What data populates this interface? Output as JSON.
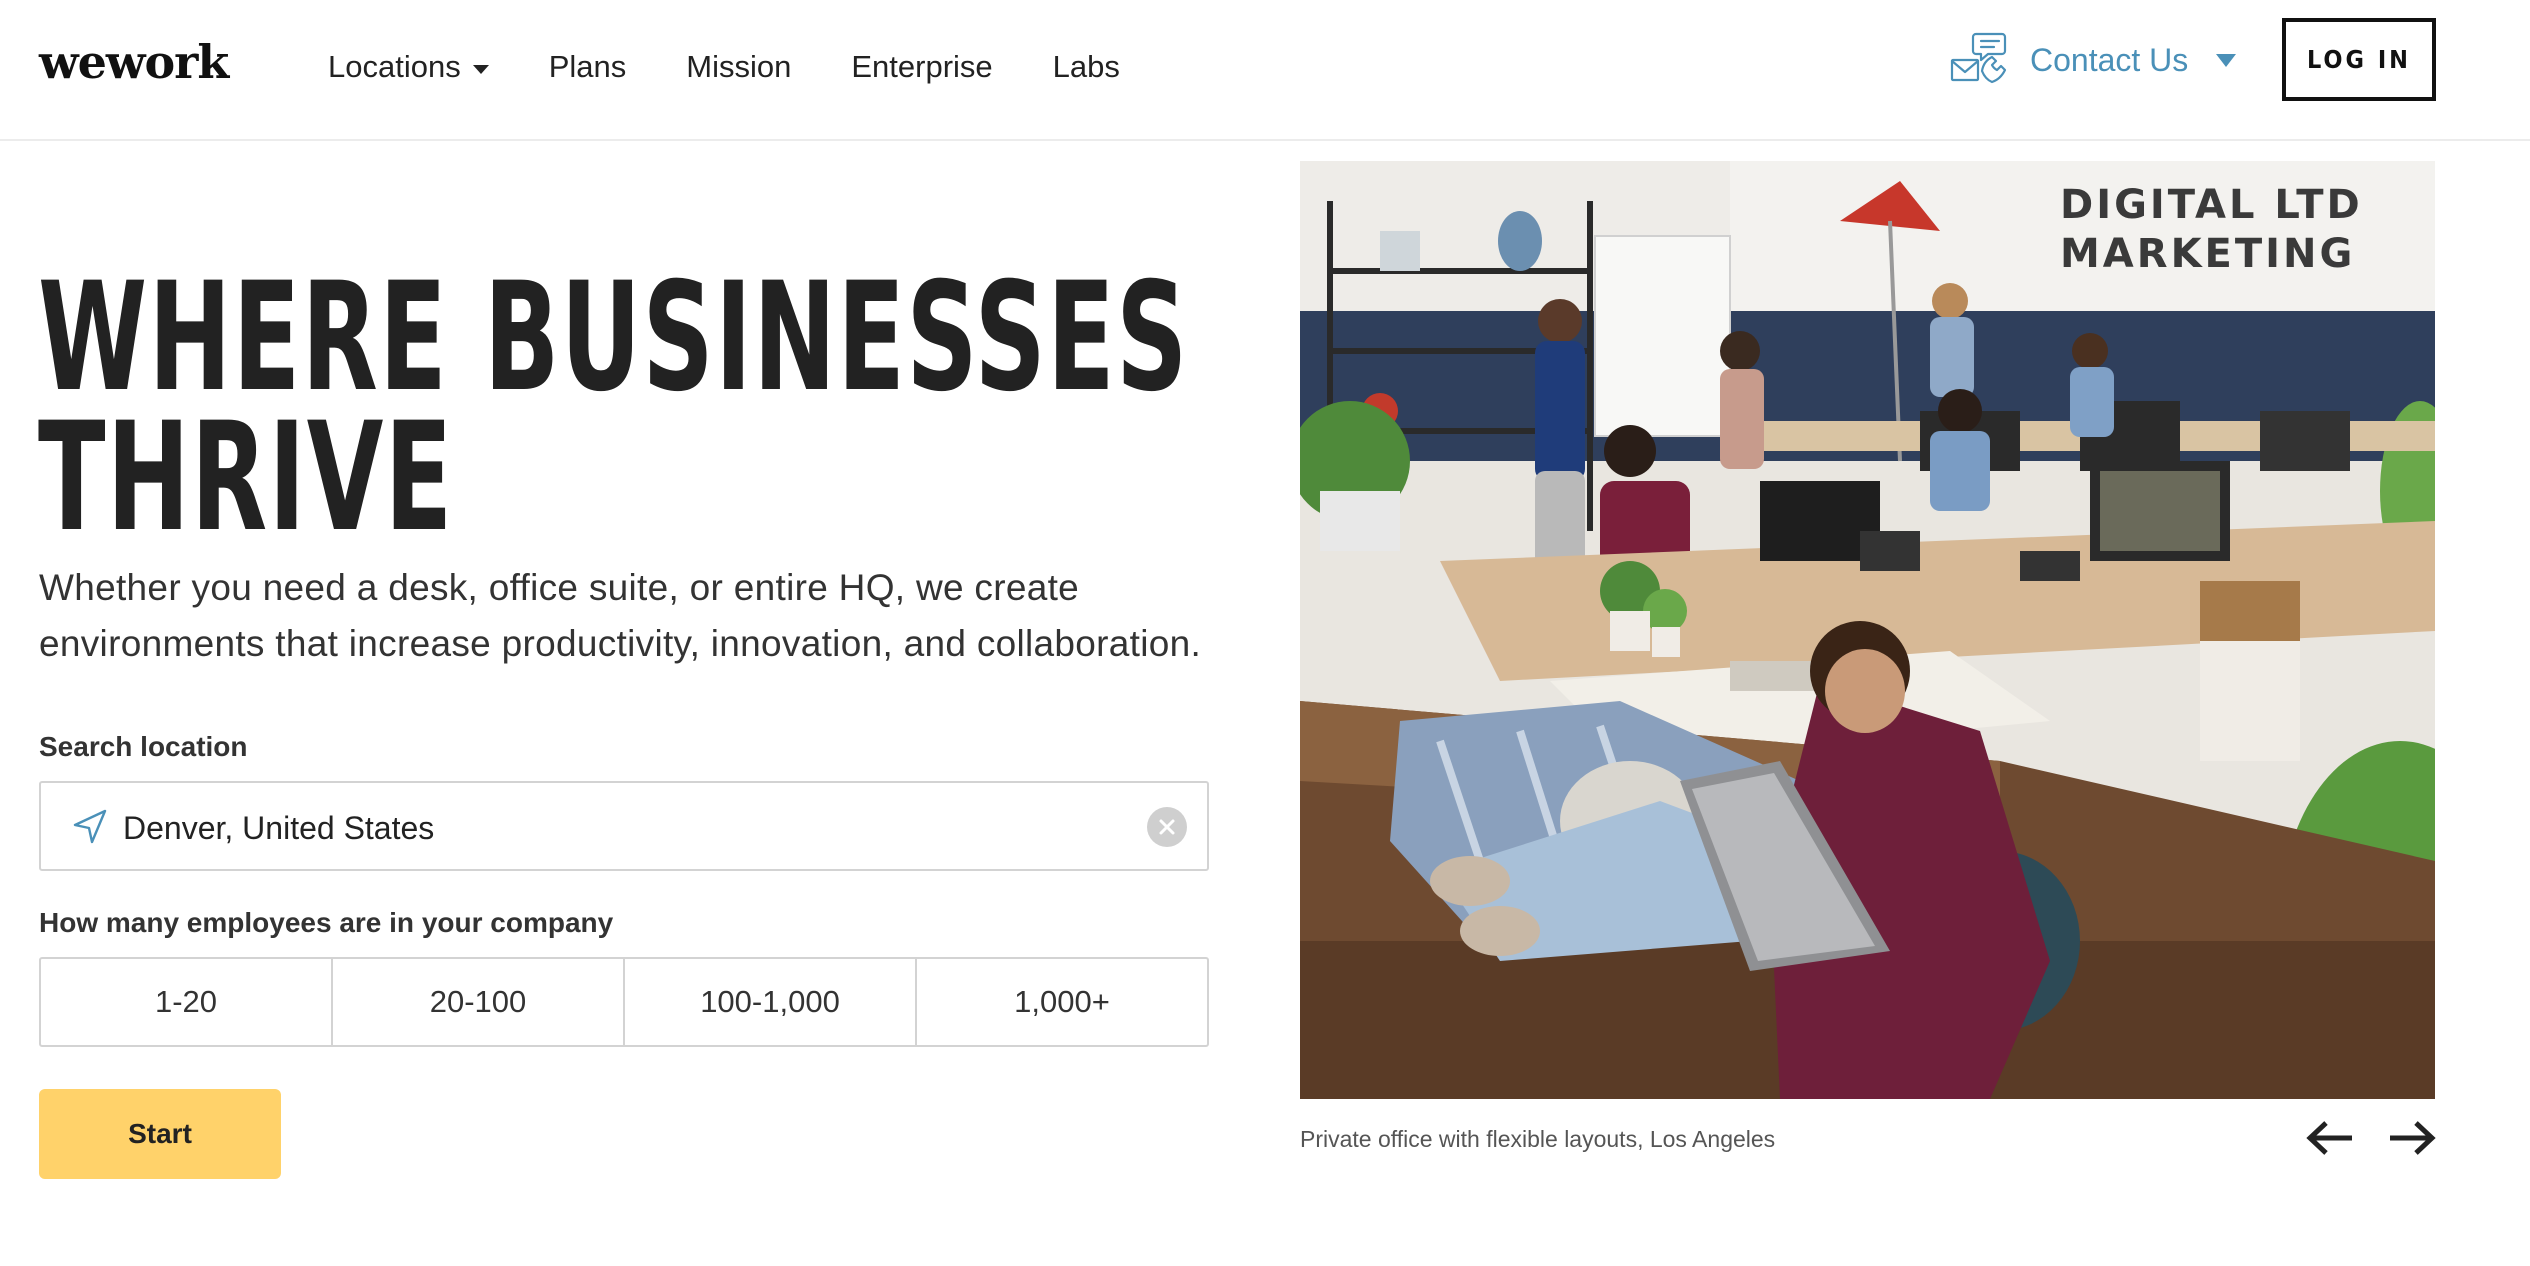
{
  "brand": {
    "logo_text": "wework"
  },
  "nav": {
    "items": [
      {
        "label": "Locations",
        "has_dropdown": true
      },
      {
        "label": "Plans"
      },
      {
        "label": "Mission"
      },
      {
        "label": "Enterprise"
      },
      {
        "label": "Labs"
      }
    ],
    "contact_label": "Contact Us",
    "login_label": "LOG IN"
  },
  "hero": {
    "headline_line1": "WHERE BUSINESSES",
    "headline_line2": "THRIVE",
    "subtitle": "Whether you need a desk, office suite, or entire HQ, we create environments that increase productivity, innovation, and collaboration."
  },
  "search": {
    "label": "Search location",
    "value": "Denver, United States"
  },
  "employees": {
    "label": "How many employees are in your company",
    "options": [
      "1-20",
      "20-100",
      "100-1,000",
      "1,000+"
    ]
  },
  "start_label": "Start",
  "photo": {
    "sign_line1": "DIGITAL LTD",
    "sign_line2": "MARKETING",
    "caption": "Private office with flexible layouts, Los Angeles"
  },
  "colors": {
    "accent_yellow": "#ffd26a",
    "link_blue": "#4a90b8",
    "text_dark": "#222222",
    "border_gray": "#d3d3d3"
  }
}
